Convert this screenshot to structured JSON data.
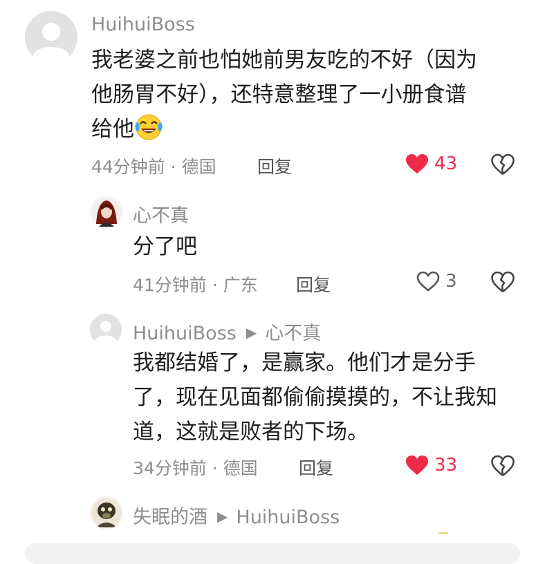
{
  "comments": [
    {
      "username": "HuihuiBoss",
      "text_lines": [
        "我老婆之前也怕她前男友吃的不好（因为",
        "他肠胃不好），还特意整理了一小册食谱",
        "给他"
      ],
      "emoji": "crying-laughing-emoji",
      "time": "44分钟前",
      "location": "德国",
      "reply_label": "回复",
      "likes": "43",
      "liked": true
    },
    {
      "username": "心不真",
      "text_lines": [
        "分了吧"
      ],
      "time": "41分钟前",
      "location": "广东",
      "reply_label": "回复",
      "likes": "3",
      "liked": false
    },
    {
      "username": "HuihuiBoss",
      "reply_to": "心不真",
      "text_lines": [
        "我都结婚了，是赢家。他们才是分手",
        "了，现在见面都偷偷摸摸的，不让我知",
        "道，这就是败者的下场。"
      ],
      "time": "34分钟前",
      "location": "德国",
      "reply_label": "回复",
      "likes": "33",
      "liked": true
    },
    {
      "username": "失眠的酒",
      "reply_to": "HuihuiBoss"
    }
  ],
  "colors": {
    "like_active": "#f02a4b",
    "meta_gray": "#8e8e8e"
  },
  "icons": {
    "heart_filled": "heart-filled-icon",
    "heart_outline": "heart-outline-icon",
    "broken_heart": "broken-heart-icon",
    "reply_arrow": "triangle-right-icon"
  }
}
